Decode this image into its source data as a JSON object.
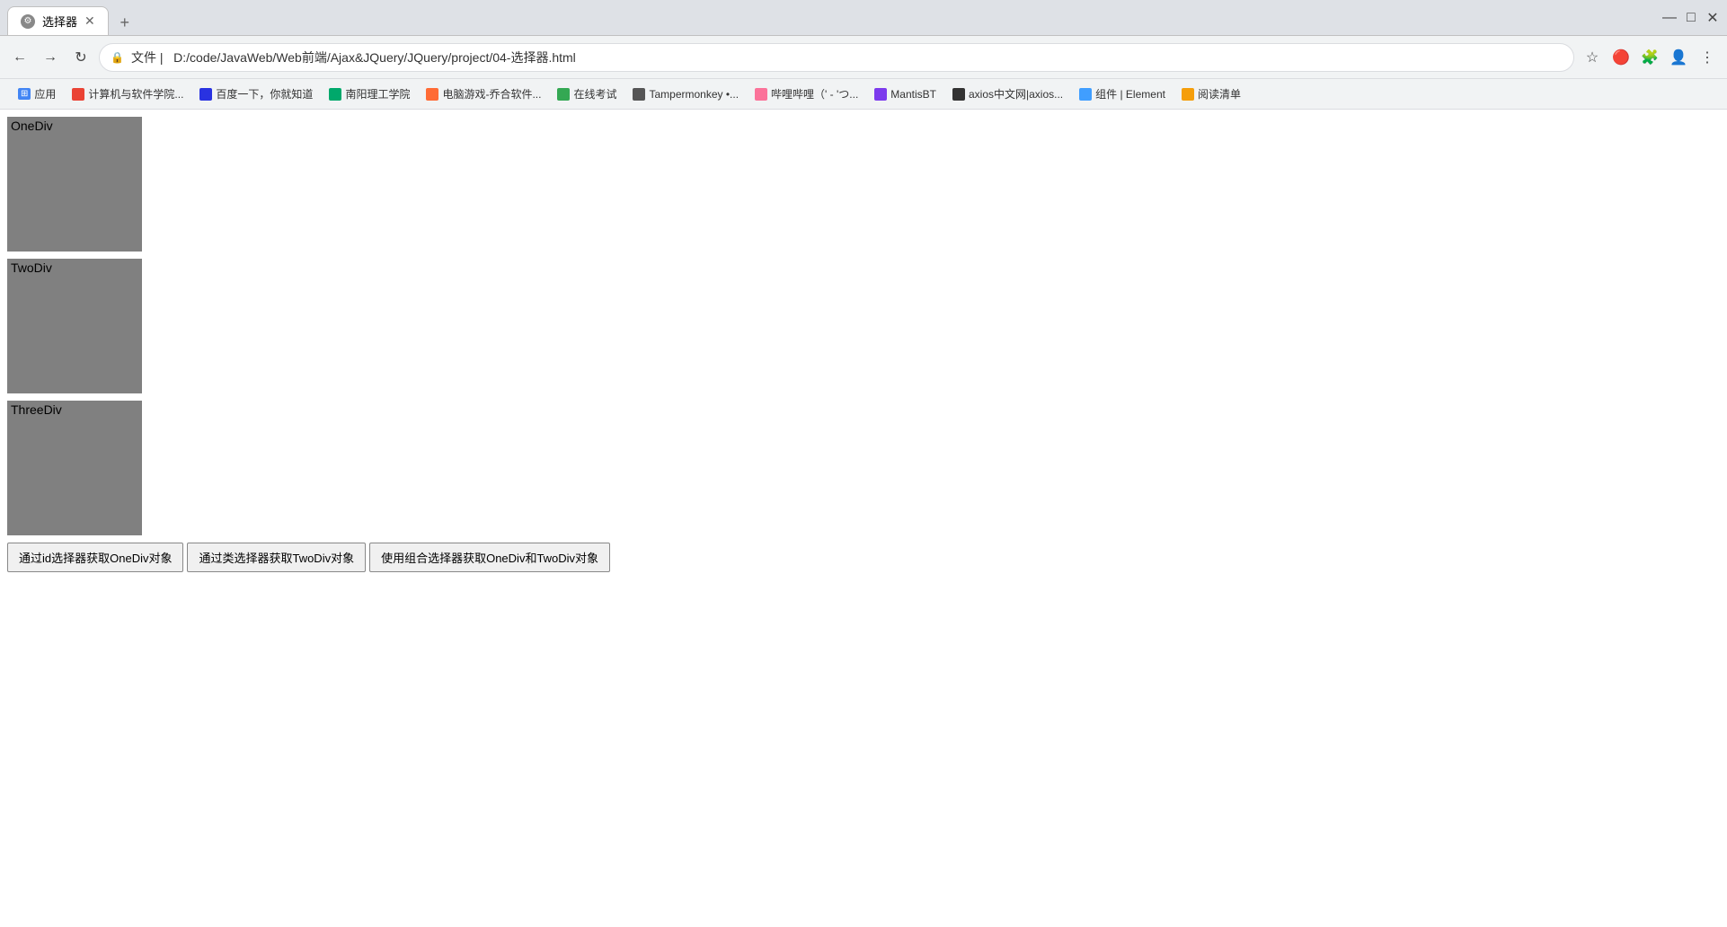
{
  "browser": {
    "tab_title": "选择器",
    "tab_favicon": "⚙",
    "address_bar_prefix": "文件 |",
    "address_url": "D:/code/JavaWeb/Web前端/Ajax&JQuery/JQuery/project/04-选择器.html",
    "new_tab_icon": "+",
    "window_minimize": "—",
    "window_maximize": "□",
    "window_close": "✕",
    "nav_back": "←",
    "nav_forward": "→",
    "nav_refresh": "↻",
    "bookmarks": [
      {
        "label": "应用",
        "icon": "apps"
      },
      {
        "label": "计算机与软件学院...",
        "icon": "edu"
      },
      {
        "label": "百度一下，你就知道",
        "icon": "baidu"
      },
      {
        "label": "南阳理工学院",
        "icon": "nylt"
      },
      {
        "label": "电脑游戏-乔合软件...",
        "icon": "game"
      },
      {
        "label": "在线考试",
        "icon": "exam"
      },
      {
        "label": "Tampermonkey •...",
        "icon": "monkey"
      },
      {
        "label": "哔哩哔哩（' - 'つ...",
        "icon": "bili"
      },
      {
        "label": "MantisBT",
        "icon": "mantis"
      },
      {
        "label": "axios中文网|axios...",
        "icon": "axios"
      },
      {
        "label": "组件 | Element",
        "icon": "element"
      },
      {
        "label": "阅读清单",
        "icon": "read"
      }
    ]
  },
  "page": {
    "divs": [
      {
        "id": "one-div",
        "label": "OneDiv"
      },
      {
        "id": "two-div",
        "label": "TwoDiv"
      },
      {
        "id": "three-div",
        "label": "ThreeDiv"
      }
    ],
    "buttons": [
      {
        "id": "btn-id",
        "label": "通过id选择器获取OneDiv对象"
      },
      {
        "id": "btn-class",
        "label": "通过类选择器获取TwoDiv对象"
      },
      {
        "id": "btn-combo",
        "label": "使用组合选择器获取OneDiv和TwoDiv对象"
      }
    ]
  }
}
